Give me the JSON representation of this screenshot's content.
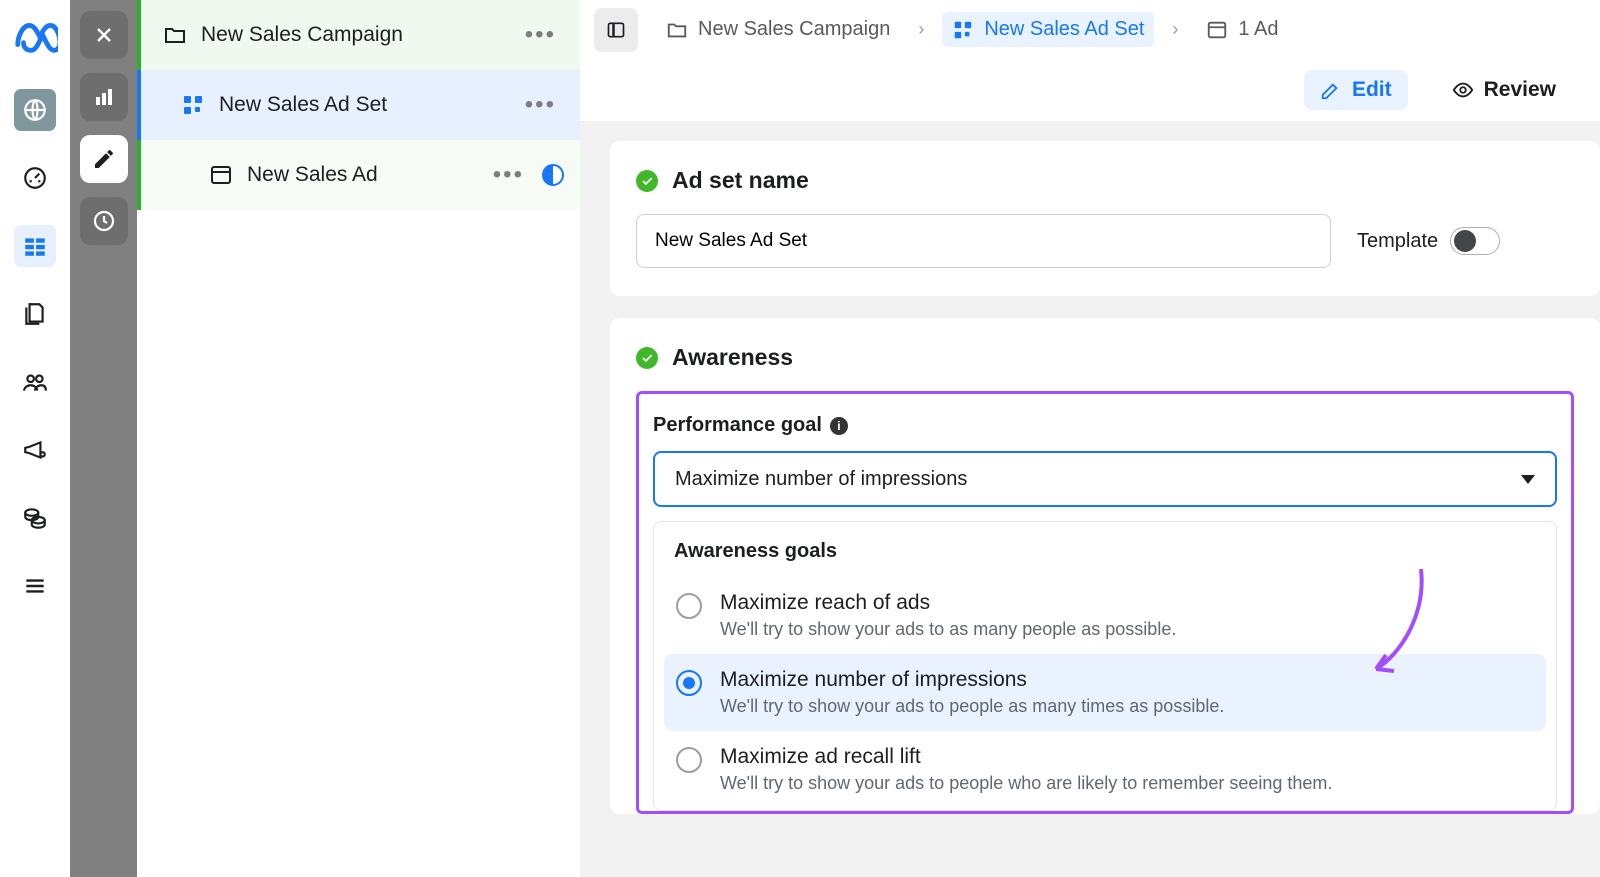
{
  "tree": {
    "campaign": "New Sales Campaign",
    "adset": "New Sales Ad Set",
    "ad": "New Sales Ad"
  },
  "breadcrumb": {
    "campaign": "New Sales Campaign",
    "adset": "New Sales Ad Set",
    "ad": "1 Ad"
  },
  "actions": {
    "edit": "Edit",
    "review": "Review"
  },
  "adset_name": {
    "title": "Ad set name",
    "value": "New Sales Ad Set",
    "template_label": "Template"
  },
  "awareness": {
    "title": "Awareness",
    "perf_label": "Performance goal",
    "selected": "Maximize number of impressions",
    "group_title": "Awareness goals",
    "options": [
      {
        "t": "Maximize reach of ads",
        "d": "We'll try to show your ads to as many people as possible."
      },
      {
        "t": "Maximize number of impressions",
        "d": "We'll try to show your ads to people as many times as possible."
      },
      {
        "t": "Maximize ad recall lift",
        "d": "We'll try to show your ads to people who are likely to remember seeing them."
      }
    ]
  }
}
